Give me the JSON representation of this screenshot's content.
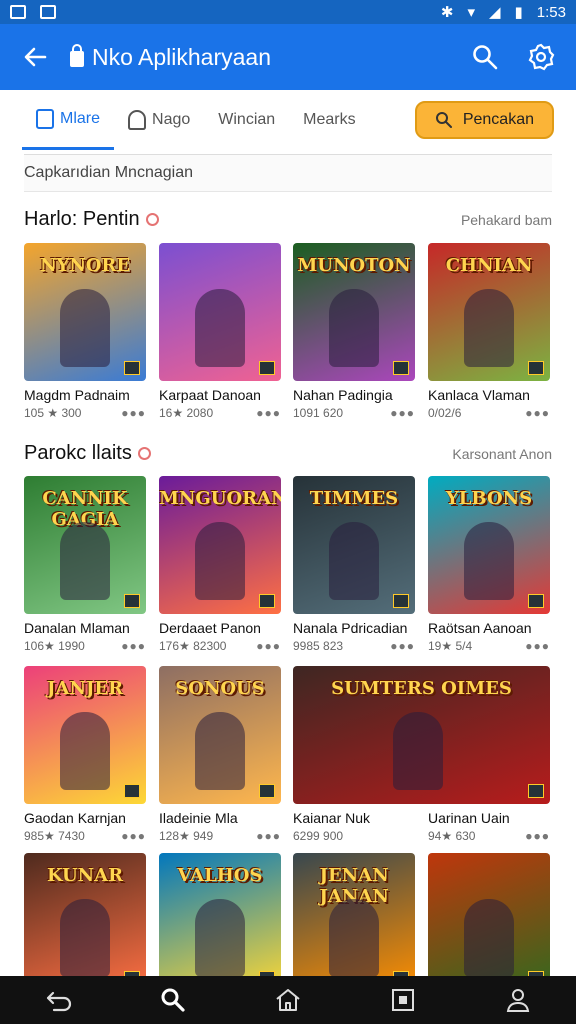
{
  "status_bar": {
    "time": "1:53"
  },
  "app_bar": {
    "title": "Nko Aplikharyaan",
    "back_icon": "back-arrow-icon",
    "search_icon": "search-icon",
    "settings_icon": "gear-icon"
  },
  "tabs": [
    {
      "label": "Mlare",
      "icon": "trash-icon",
      "active": true
    },
    {
      "label": "Nago",
      "icon": "person-icon",
      "active": false
    },
    {
      "label": "Wincian",
      "active": false
    },
    {
      "label": "Mearks",
      "active": false
    }
  ],
  "tab_cta": {
    "label": "Pencakan",
    "icon": "search-icon"
  },
  "filter": {
    "text": "Capkarıdian Mncnagian"
  },
  "sections": [
    {
      "title": "Harlo: Pentin",
      "see_all": "Pehakard bam",
      "cards": [
        {
          "thumb_title": "NYNORE",
          "name": "Magdm Padnaim",
          "meta": "105 ★ 300",
          "colors": [
            "#f4a52c",
            "#3a7bd5"
          ]
        },
        {
          "thumb_title": "",
          "name": "Karpaat Danoan",
          "meta": "16★ 2080",
          "colors": [
            "#7b4fd1",
            "#f06292"
          ]
        },
        {
          "thumb_title": "MUNOTON",
          "name": "Nahan Padingia",
          "meta": "1091 620",
          "colors": [
            "#1b5e20",
            "#ab47bc"
          ]
        },
        {
          "thumb_title": "CHNIAN",
          "name": "Kanlaca Vlaman",
          "meta": "0/02/6",
          "colors": [
            "#c62828",
            "#7cb342"
          ]
        }
      ]
    },
    {
      "title": "Parokc llaits",
      "see_all": "Karsonant Anon",
      "cards": [
        {
          "thumb_title": "CANNIK GAGIA",
          "name": "Danalan Mlaman",
          "meta": "106★ 1990",
          "colors": [
            "#2e7d32",
            "#81c784"
          ]
        },
        {
          "thumb_title": "MNGUORAN",
          "name": "Derdaaet Panon",
          "meta": "176★ 82300",
          "colors": [
            "#6a1b9a",
            "#ff7043"
          ]
        },
        {
          "thumb_title": "TIMMES",
          "name": "Nanala Pdricadian",
          "meta": "9985 823",
          "colors": [
            "#263238",
            "#546e7a"
          ]
        },
        {
          "thumb_title": "YLBONS",
          "name": "Raötsan Aanoan",
          "meta": "19★ 5/4",
          "colors": [
            "#00acc1",
            "#e53935"
          ]
        },
        {
          "thumb_title": "JANJER",
          "name": "Gaodan Karnjan",
          "meta": "985★ 7430",
          "colors": [
            "#ec407a",
            "#fdd835"
          ]
        },
        {
          "thumb_title": "SONOUS",
          "name": "Iladeinie Mla",
          "meta": "128★ 949",
          "colors": [
            "#8d6e63",
            "#ffb74d"
          ]
        },
        {
          "thumb_title": "SUMTERS OIMES",
          "name": "Kaianar Nuk",
          "meta": "6299 900",
          "colors": [
            "#3e2723",
            "#b71c1c"
          ],
          "wide": true
        },
        {
          "thumb_title": "",
          "name": "Uarinan Uain",
          "meta": "94★ 630",
          "colors": [
            "#b71c1c",
            "#212121"
          ],
          "hidden": true
        },
        {
          "thumb_title": "KUNAR",
          "name": "",
          "meta": "",
          "colors": [
            "#4e2a1e",
            "#ff7043"
          ]
        },
        {
          "thumb_title": "VALHOS",
          "name": "",
          "meta": "",
          "colors": [
            "#0277bd",
            "#fdd835"
          ]
        },
        {
          "thumb_title": "JENAN JANAN",
          "name": "",
          "meta": "",
          "colors": [
            "#37474f",
            "#ff8f00"
          ]
        },
        {
          "thumb_title": "",
          "name": "",
          "meta": "",
          "colors": [
            "#bf360c",
            "#33691e"
          ]
        }
      ]
    }
  ],
  "nav": [
    "back-nav-icon",
    "search-nav-icon",
    "home-nav-icon",
    "square-nav-icon",
    "profile-nav-icon"
  ],
  "colors": {
    "app_bar": "#1a73e8",
    "status_bar": "#1565c0",
    "cta": "#fbb437",
    "nav": "#111111"
  }
}
